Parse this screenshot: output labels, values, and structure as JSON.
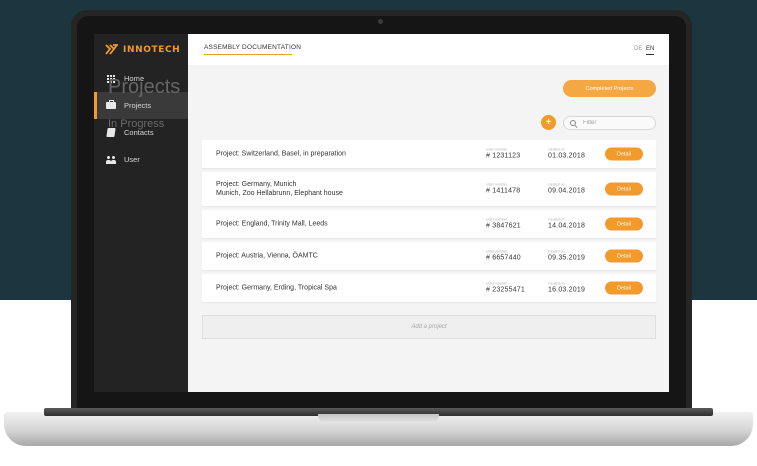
{
  "brand": {
    "name": "INNOTECH",
    "color": "#f39a2c",
    "icon": "innotech-logo-icon"
  },
  "sidebar": {
    "items": [
      {
        "label": "Home",
        "icon": "grid-icon",
        "active": false
      },
      {
        "label": "Projects",
        "icon": "briefcase-icon",
        "active": true
      },
      {
        "label": "Contacts",
        "icon": "book-icon",
        "active": false
      },
      {
        "label": "User",
        "icon": "users-icon",
        "active": false
      }
    ]
  },
  "topbar": {
    "title": "ASSEMBLY DOCUMENTATION",
    "languages": [
      "DE",
      "EN"
    ],
    "active_language": "EN"
  },
  "main": {
    "title": "Projects",
    "completed_button": "Completed Projects",
    "section_title": "In Progress",
    "add_button": "+",
    "filter_placeholder": "Filter",
    "add_project_label": "Add a project"
  },
  "projects": {
    "order_label": "order number",
    "created_label": "created on",
    "detail_label": "Detail",
    "rows": [
      {
        "name": "Project: Switzerland, Basel, in preparation",
        "name2": "",
        "order": "# 1231123",
        "created": "01.03.2018"
      },
      {
        "name": "Project: Germany, Munich",
        "name2": "Munich, Zoo Hellabrunn, Elephant house",
        "order": "# 1411478",
        "created": "09.04.2018"
      },
      {
        "name": "Project: England, Trinity Mall, Leeds",
        "name2": "",
        "order": "# 3847621",
        "created": "14.04.2018"
      },
      {
        "name": "Project: Austria, Vienna, ÖAMTC",
        "name2": "",
        "order": "# 6657440",
        "created": "09.35.2019"
      },
      {
        "name": "Project: Germany, Erding, Tropical Spa",
        "name2": "",
        "order": "# 23255471",
        "created": "16.03.2019"
      }
    ]
  },
  "colors": {
    "accent": "#f39a2c",
    "sidebar_bg": "#232323",
    "backdrop": "#1c3640",
    "content_bg": "#f4f4f4"
  }
}
